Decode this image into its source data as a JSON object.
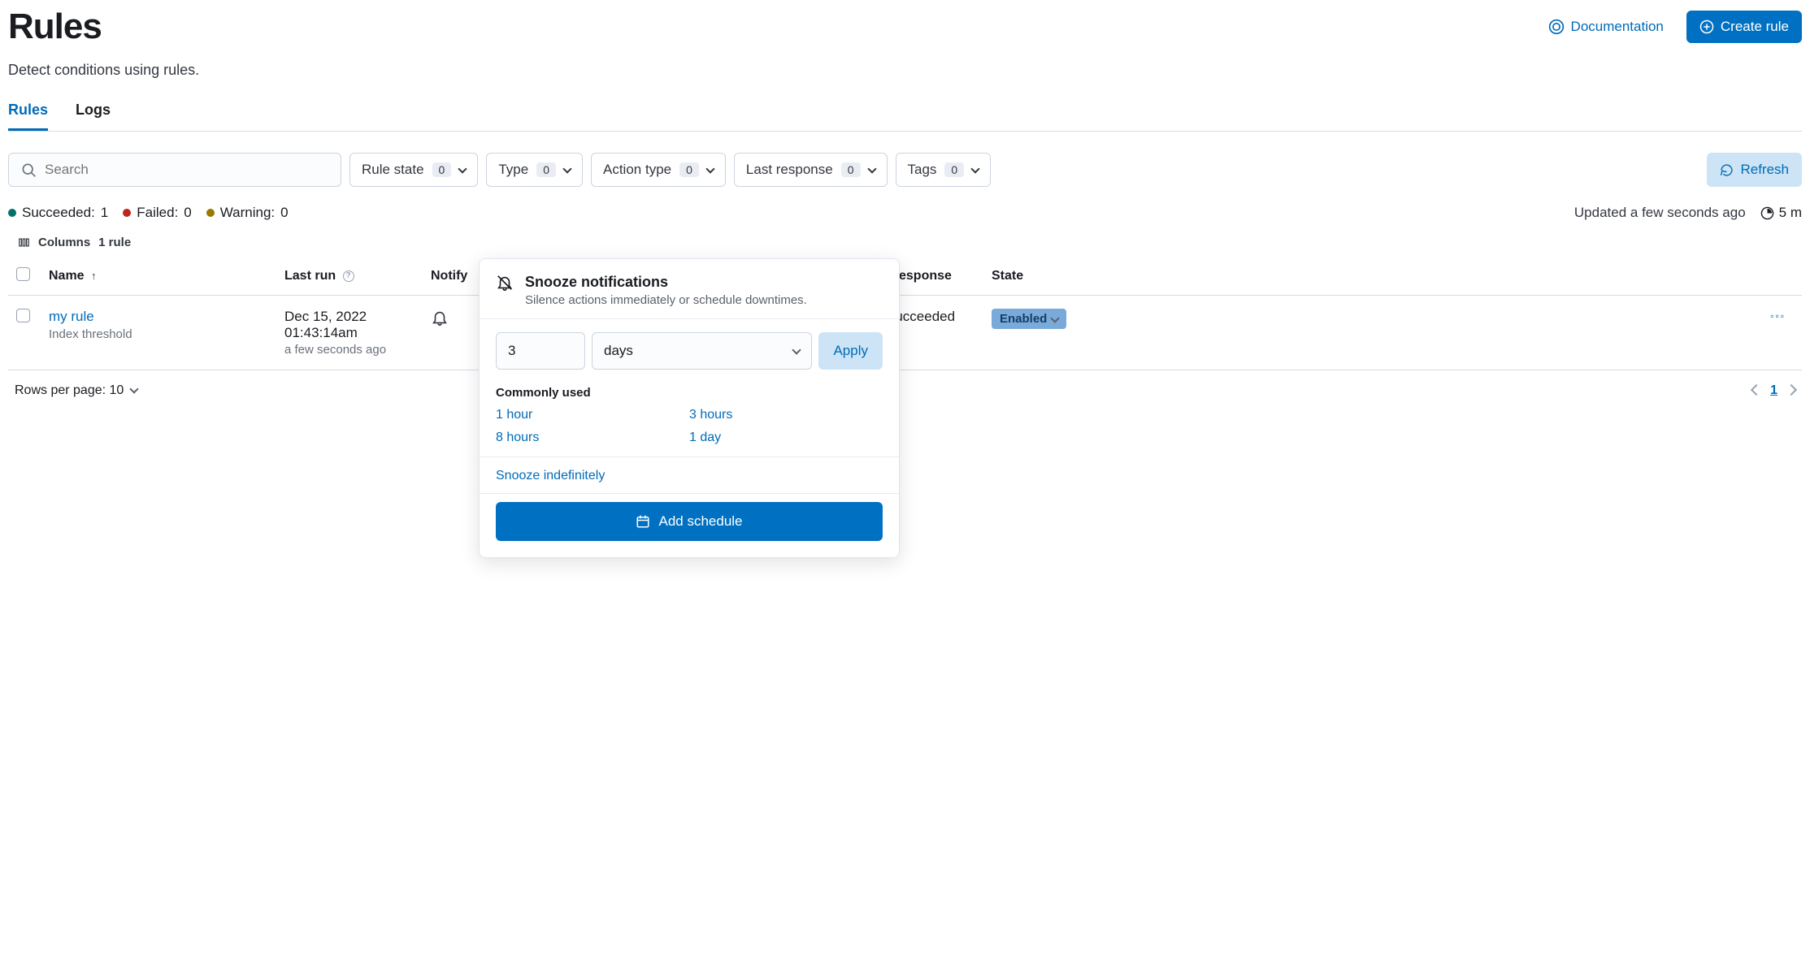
{
  "header": {
    "title": "Rules",
    "subtitle": "Detect conditions using rules.",
    "doc_link": "Documentation",
    "create_btn": "Create rule"
  },
  "tabs": {
    "rules": "Rules",
    "logs": "Logs"
  },
  "search": {
    "placeholder": "Search"
  },
  "filters": {
    "rule_state": {
      "label": "Rule state",
      "count": "0"
    },
    "type": {
      "label": "Type",
      "count": "0"
    },
    "action_type": {
      "label": "Action type",
      "count": "0"
    },
    "last_response": {
      "label": "Last response",
      "count": "0"
    },
    "tags": {
      "label": "Tags",
      "count": "0"
    }
  },
  "refresh_btn": "Refresh",
  "status": {
    "succeeded": {
      "label": "Succeeded:",
      "value": "1"
    },
    "failed": {
      "label": "Failed:",
      "value": "0"
    },
    "warning": {
      "label": "Warning:",
      "value": "0"
    },
    "updated_text": "Updated a few seconds ago",
    "interval": "5 m"
  },
  "columns_toggle": "Columns",
  "rule_count": "1 rule",
  "table_headers": {
    "name": "Name",
    "last_run": "Last run",
    "notify": "Notify",
    "last_response": "t response",
    "state": "State"
  },
  "rules": [
    {
      "name": "my rule",
      "type": "Index threshold",
      "last_run_date": "Dec 15, 2022",
      "last_run_time": "01:43:14am",
      "last_run_rel": "a few seconds ago",
      "last_response": "Succeeded",
      "state": "Enabled"
    }
  ],
  "footer": {
    "rows_per_page": "Rows per page: 10",
    "page": "1"
  },
  "popover": {
    "title": "Snooze notifications",
    "subtitle": "Silence actions immediately or schedule downtimes.",
    "number_value": "3",
    "unit_value": "days",
    "apply": "Apply",
    "commonly_used_title": "Commonly used",
    "common": [
      "1 hour",
      "3 hours",
      "8 hours",
      "1 day"
    ],
    "snooze_indef": "Snooze indefinitely",
    "add_schedule": "Add schedule"
  }
}
